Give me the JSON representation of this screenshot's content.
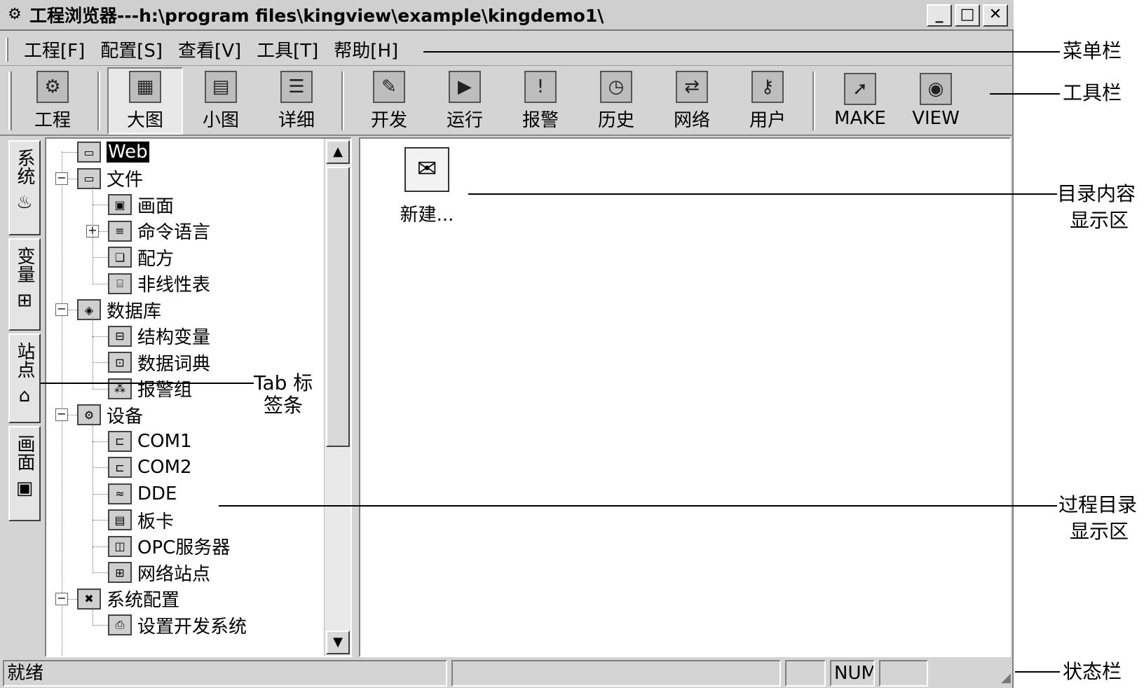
{
  "window": {
    "title": "工程浏览器---h:\\program files\\kingview\\example\\kingdemo1\\",
    "controls": {
      "minimize": "_",
      "maximize": "□",
      "close": "✕"
    }
  },
  "menu": [
    "工程[F]",
    "配置[S]",
    "查看[V]",
    "工具[T]",
    "帮助[H]"
  ],
  "toolbar": {
    "group1": [
      {
        "label": "工程",
        "icon": "project-icon",
        "glyph": "⚙"
      }
    ],
    "group2": [
      {
        "label": "大图",
        "icon": "large-icons-icon",
        "glyph": "▦",
        "pressed": true
      },
      {
        "label": "小图",
        "icon": "small-icons-icon",
        "glyph": "▤"
      },
      {
        "label": "详细",
        "icon": "details-icon",
        "glyph": "☰"
      }
    ],
    "group3": [
      {
        "label": "开发",
        "icon": "develop-icon",
        "glyph": "✎"
      },
      {
        "label": "运行",
        "icon": "run-icon",
        "glyph": "▶"
      },
      {
        "label": "报警",
        "icon": "alarm-icon",
        "glyph": "!"
      },
      {
        "label": "历史",
        "icon": "history-icon",
        "glyph": "◷"
      },
      {
        "label": "网络",
        "icon": "network-icon",
        "glyph": "⇄"
      },
      {
        "label": "用户",
        "icon": "user-key-icon",
        "glyph": "⚷"
      }
    ],
    "group4": [
      {
        "label": "MAKE",
        "icon": "make-icon",
        "glyph": "➚"
      },
      {
        "label": "VIEW",
        "icon": "view-icon",
        "glyph": "◉"
      }
    ]
  },
  "tabs": [
    {
      "label": "系统",
      "icon": "system-tab-icon",
      "glyph": "♨"
    },
    {
      "label": "变量",
      "icon": "variable-tab-icon",
      "glyph": "⊞"
    },
    {
      "label": "站点",
      "icon": "station-tab-icon",
      "glyph": "⌂"
    },
    {
      "label": "画面",
      "icon": "screen-tab-icon",
      "glyph": "▣"
    }
  ],
  "tree": [
    {
      "label": "Web",
      "icon": "web-folder-icon",
      "glyph": "▭",
      "level": 0,
      "selected": true
    },
    {
      "label": "文件",
      "icon": "folder-icon",
      "glyph": "▭",
      "level": 0,
      "expander": "−"
    },
    {
      "label": "画面",
      "icon": "screen-icon",
      "glyph": "▣",
      "level": 1
    },
    {
      "label": "命令语言",
      "icon": "command-language-icon",
      "glyph": "≡",
      "level": 1,
      "expander": "+"
    },
    {
      "label": "配方",
      "icon": "recipe-icon",
      "glyph": "❏",
      "level": 1
    },
    {
      "label": "非线性表",
      "icon": "nonlinear-table-icon",
      "glyph": "⌸",
      "level": 1
    },
    {
      "label": "数据库",
      "icon": "database-icon",
      "glyph": "◈",
      "level": 0,
      "expander": "−"
    },
    {
      "label": "结构变量",
      "icon": "struct-variable-icon",
      "glyph": "⊟",
      "level": 1
    },
    {
      "label": "数据词典",
      "icon": "data-dictionary-icon",
      "glyph": "⊡",
      "level": 1
    },
    {
      "label": "报警组",
      "icon": "alarm-group-icon",
      "glyph": "⁂",
      "level": 1
    },
    {
      "label": "设备",
      "icon": "device-icon",
      "glyph": "⚙",
      "level": 0,
      "expander": "−"
    },
    {
      "label": "COM1",
      "icon": "com-port-icon",
      "glyph": "⊏",
      "level": 1
    },
    {
      "label": "COM2",
      "icon": "com-port-icon",
      "glyph": "⊏",
      "level": 1
    },
    {
      "label": "DDE",
      "icon": "dde-icon",
      "glyph": "≈",
      "level": 1
    },
    {
      "label": "板卡",
      "icon": "board-card-icon",
      "glyph": "▤",
      "level": 1
    },
    {
      "label": "OPC服务器",
      "icon": "opc-server-icon",
      "glyph": "◫",
      "level": 1
    },
    {
      "label": "网络站点",
      "icon": "network-station-icon",
      "glyph": "⊞",
      "level": 1
    },
    {
      "label": "系统配置",
      "icon": "tools-icon",
      "glyph": "✖",
      "level": 0,
      "expander": "−"
    },
    {
      "label": "设置开发系统",
      "icon": "setup-dev-icon",
      "glyph": "⎙",
      "level": 1
    }
  ],
  "scrollbar": {
    "up": "▲",
    "down": "▼"
  },
  "content": {
    "items": [
      {
        "label": "新建...",
        "icon": "new-item-icon",
        "glyph": "✉"
      }
    ]
  },
  "statusbar": {
    "status": "就绪",
    "num": "NUM"
  },
  "annotations": {
    "menubar": "菜单栏",
    "toolbar": "工具栏",
    "content_area": [
      "目录内容",
      "显示区"
    ],
    "tab_strip": [
      "Tab 标",
      "签条"
    ],
    "process_dir": [
      "过程目录",
      "显示区"
    ],
    "statusbar": "状态栏"
  }
}
